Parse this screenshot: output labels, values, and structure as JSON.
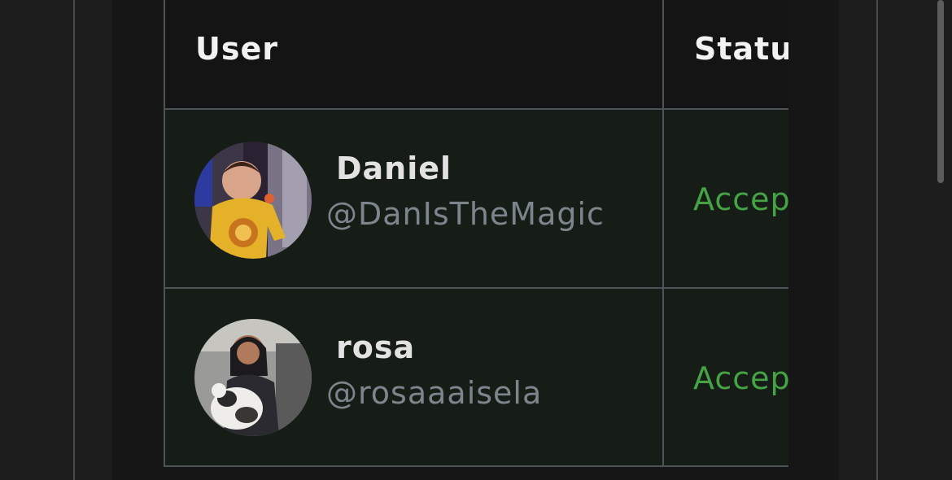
{
  "table": {
    "columns": [
      "User",
      "Status"
    ],
    "rows": [
      {
        "display_name": "Daniel",
        "handle": "@DanIsTheMagic",
        "status": "Accepted",
        "avatar": "child-photo-avatar"
      },
      {
        "display_name": "rosa",
        "handle": "@rosaaaisela",
        "status": "Accepted",
        "avatar": "woman-with-cat-photo-avatar"
      }
    ]
  },
  "colors": {
    "status_accepted": "#45a345",
    "handle_gray": "#7d858c",
    "row_background": "#161d17",
    "border": "#4d5358"
  }
}
